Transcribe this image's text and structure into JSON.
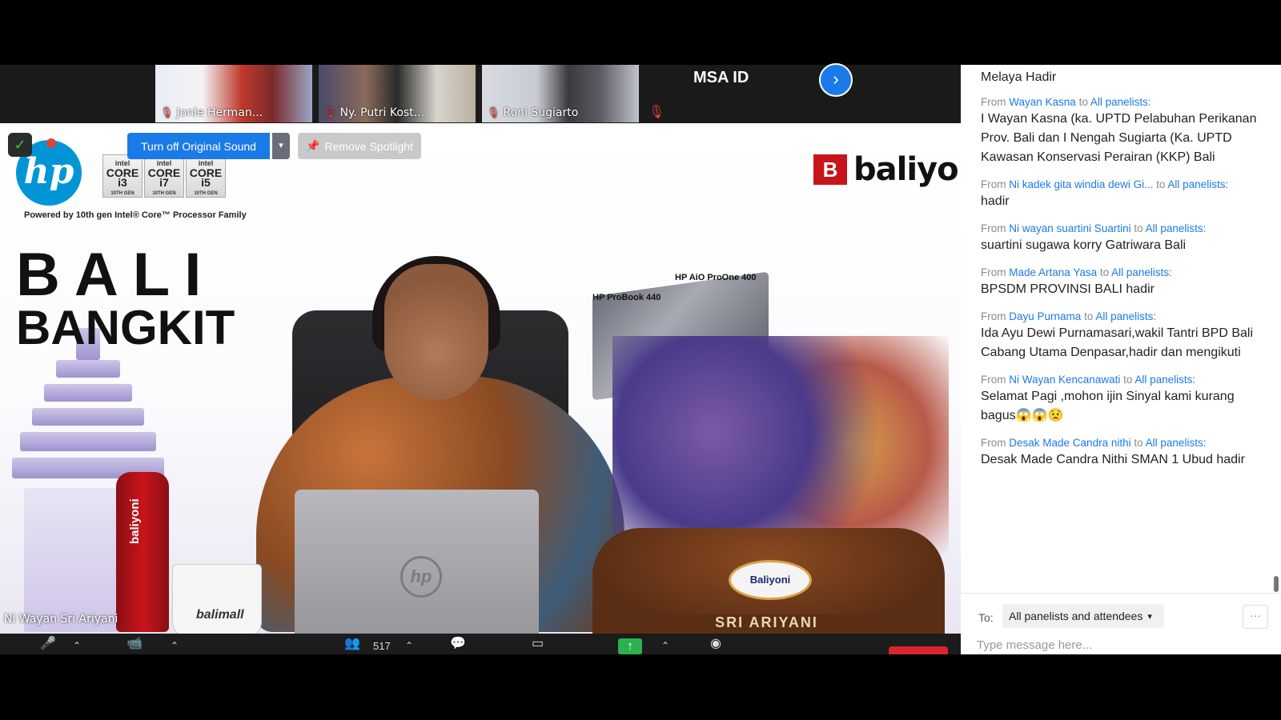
{
  "thumbnails": [
    {
      "name": "Jonie Herman..."
    },
    {
      "name": "Ny. Putri Kost..."
    },
    {
      "name": "Roni Sugiarto"
    }
  ],
  "msa_label": "MSA ID",
  "video": {
    "hp_logo": "hp",
    "intel_chips": [
      {
        "brand": "intel",
        "label": "CORE i3",
        "gen": "10TH GEN"
      },
      {
        "brand": "intel",
        "label": "CORE i7",
        "gen": "10TH GEN"
      },
      {
        "brand": "intel",
        "label": "CORE i5",
        "gen": "10TH GEN"
      }
    ],
    "powered_by": "Powered by 10th gen Intel® Core™ Processor Family",
    "title_line1": "BALI",
    "title_line2": "BANGKIT",
    "brand_icon": "B",
    "brand_name": "baliyoni",
    "product_labels": [
      "HP AiO ProOne 400",
      "HP ProBook 440"
    ],
    "mug_text": "balimall",
    "bottle_text": "baliyoni",
    "nameplate": "Baliyoni",
    "desk_plate": "SRI ARIYANI",
    "speaker_name": "Ni Wayan Sri Ariyani",
    "original_sound_button": "Turn off Original Sound",
    "remove_spotlight_button": "Remove Spotlight"
  },
  "toolbar": {
    "participants_count": "517"
  },
  "chat": {
    "first_line": "Melaya Hadir",
    "messages": [
      {
        "from": "Wayan Kasna",
        "to": "All panelists:",
        "text": "I Wayan Kasna (ka. UPTD Pelabuhan Perikanan Prov. Bali dan I Nengah Sugiarta (Ka. UPTD Kawasan Konservasi Perairan (KKP) Bali"
      },
      {
        "from": "Ni kadek gita windia dewi Gi...",
        "to": "All panelists:",
        "text": "hadir"
      },
      {
        "from": "Ni wayan suartini Suartini",
        "to": "All panelists:",
        "text": "suartini sugawa korry Gatriwara Bali"
      },
      {
        "from": "Made Artana Yasa",
        "to": "All panelists:",
        "text": "BPSDM PROVINSI BALI hadir"
      },
      {
        "from": "Dayu Purnama",
        "to": "All panelists:",
        "text": "Ida Ayu Dewi Purnamasari,wakil Tantri BPD Bali Cabang Utama Denpasar,hadir dan mengikuti"
      },
      {
        "from": "Ni Wayan Kencanawati",
        "to": "All panelists:",
        "text": "Selamat Pagi ,mohon ijin Sinyal kami kurang bagus😱😱😟"
      },
      {
        "from": "Desak Made Candra nithi",
        "to": "All panelists:",
        "text": "Desak Made Candra Nithi SMAN 1 Ubud hadir"
      }
    ],
    "from_word": "From",
    "to_word": "to",
    "to_label": "To:",
    "recipient": "All panelists and attendees",
    "more": "···",
    "input_placeholder": "Type message here..."
  }
}
